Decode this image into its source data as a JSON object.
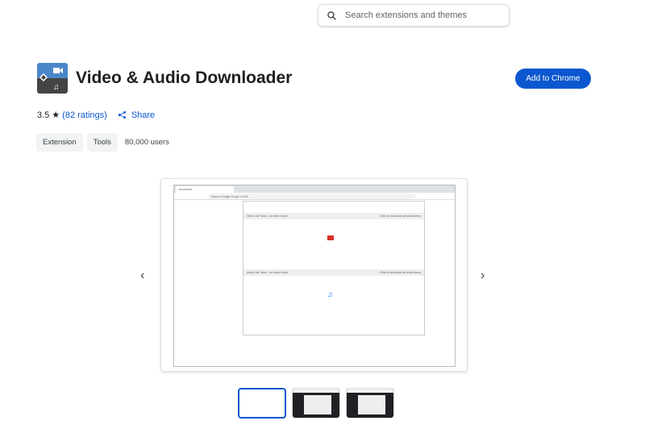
{
  "search": {
    "placeholder": "Search extensions and themes"
  },
  "extension": {
    "title": "Video & Audio Downloader",
    "add_button": "Add to Chrome",
    "rating": "3.5",
    "ratings_link": "(82 ratings)",
    "share": "Share",
    "chips": [
      "Extension",
      "Tools"
    ],
    "users": "80,000 users"
  },
  "screenshot": {
    "tab_title": "sb.content",
    "omnibox": "Search Google or type a URL",
    "video_header": "Video List Table - no video found",
    "video_action": "Click to download all video items",
    "audio_header": "Audio List Table - no audio found",
    "audio_action": "Click to download all Audio items"
  },
  "colors": {
    "accent": "#0b57d0"
  }
}
